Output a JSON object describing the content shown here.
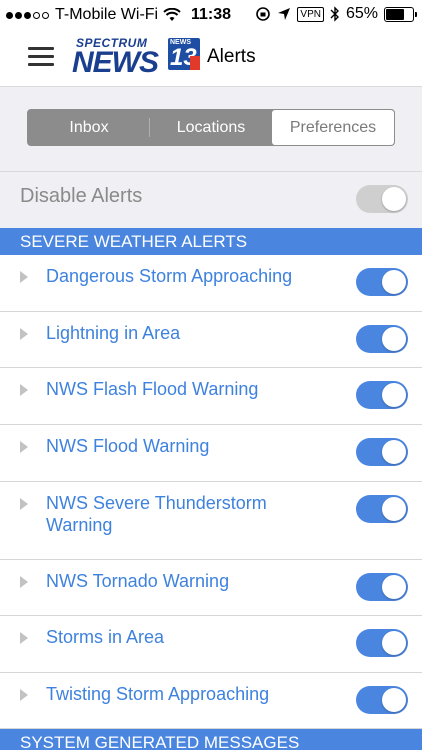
{
  "status_bar": {
    "carrier": "T-Mobile Wi-Fi",
    "time": "11:38",
    "vpn": "VPN",
    "battery": "65%",
    "battery_level": 0.65
  },
  "nav": {
    "logo_spectrum": "SPECTRUM",
    "logo_news": "NEWS",
    "logo_badge_small": "NEWS",
    "logo_badge_number": "13",
    "title": "Alerts"
  },
  "tabs": [
    {
      "label": "Inbox",
      "active": false
    },
    {
      "label": "Locations",
      "active": false
    },
    {
      "label": "Preferences",
      "active": true
    }
  ],
  "disable_alerts": {
    "label": "Disable Alerts",
    "enabled": false
  },
  "sections": [
    {
      "title": "SEVERE WEATHER ALERTS",
      "items": [
        {
          "label": "Dangerous Storm Approaching",
          "on": true
        },
        {
          "label": "Lightning in Area",
          "on": true
        },
        {
          "label": "NWS Flash Flood Warning",
          "on": true
        },
        {
          "label": "NWS Flood Warning",
          "on": true
        },
        {
          "label": "NWS Severe Thunderstorm Warning",
          "on": true
        },
        {
          "label": "NWS Tornado Warning",
          "on": true
        },
        {
          "label": "Storms in Area",
          "on": true
        },
        {
          "label": "Twisting Storm Approaching",
          "on": true
        }
      ]
    },
    {
      "title": "SYSTEM GENERATED MESSAGES",
      "items": []
    }
  ],
  "colors": {
    "accent": "#4a86e0",
    "link": "#3e82de",
    "segment_bg": "#8c8c8c",
    "page_bg": "#efeff4"
  }
}
